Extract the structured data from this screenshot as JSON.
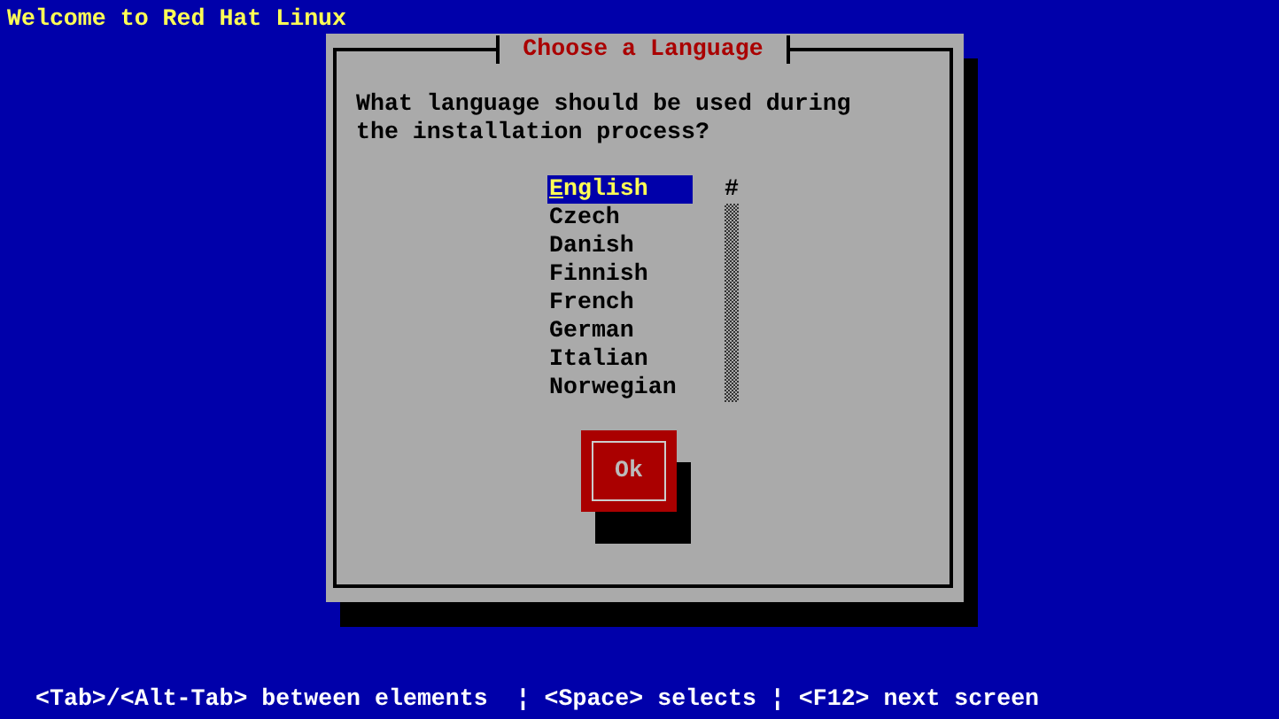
{
  "screen_title": "Welcome to Red Hat Linux",
  "dialog": {
    "title": "Choose a Language",
    "prompt": "What language should be used during the installation process?",
    "languages": [
      {
        "label": "English",
        "selected": true
      },
      {
        "label": "Czech",
        "selected": false
      },
      {
        "label": "Danish",
        "selected": false
      },
      {
        "label": "Finnish",
        "selected": false
      },
      {
        "label": "French",
        "selected": false
      },
      {
        "label": "German",
        "selected": false
      },
      {
        "label": "Italian",
        "selected": false
      },
      {
        "label": "Norwegian",
        "selected": false
      }
    ],
    "scroll_thumb": "#",
    "buttons": [
      {
        "label": "Ok"
      }
    ]
  },
  "help_line": "<Tab>/<Alt-Tab> between elements  ¦ <Space> selects ¦ <F12> next screen"
}
